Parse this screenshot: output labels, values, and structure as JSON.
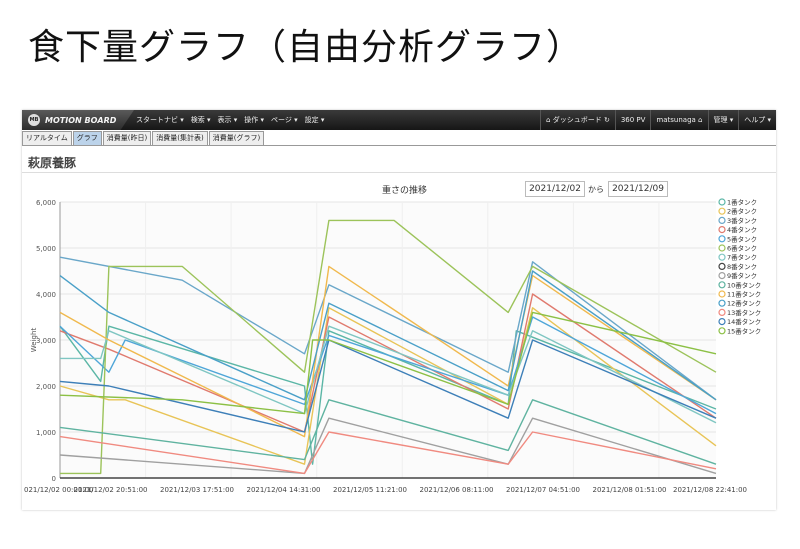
{
  "slide_title": "食下量グラフ（自由分析グラフ）",
  "app": {
    "brand": {
      "logo": "MB",
      "name": "MOTION BOARD"
    },
    "menu": [
      "スタートナビ ▾",
      "検索 ▾",
      "表示 ▾",
      "操作 ▾",
      "ページ ▾",
      "設定 ▾"
    ],
    "right": {
      "dashboard": "ダッシュボード",
      "pv": "360 PV",
      "user": "matsunaga",
      "manage": "管理 ▾",
      "help": "ヘルプ ▾"
    },
    "tabs": [
      "リアルタイム",
      "グラフ",
      "消費量(昨日)",
      "消費量(集計表)",
      "消費量(グラフ)"
    ],
    "active_tab": 1,
    "panel_title": "萩原養豚",
    "date_from": "2021/12/02",
    "date_sep": "から",
    "date_to": "2021/12/09"
  },
  "chart_data": {
    "type": "line",
    "title": "重さの推移",
    "ylabel": "Weight",
    "xlabel": "",
    "ylim": [
      0,
      6000
    ],
    "yticks": [
      0,
      1000,
      2000,
      3000,
      4000,
      5000,
      6000
    ],
    "ytick_labels": [
      "0",
      "1,000",
      "2,000",
      "3,000",
      "4,000",
      "5,000",
      "6,000"
    ],
    "xlim": [
      0,
      161
    ],
    "xtick_positions": [
      0,
      21,
      42,
      63,
      84,
      105,
      126,
      147
    ],
    "xtick_labels": [
      "021/12/02 00:01:00",
      "2021/12/02 20:51:00",
      "2021/12/03 17:51:00",
      "2021/12/04 14:31:00",
      "2021/12/05 11:21:00",
      "2021/12/06 08:11:00",
      "2021/12/07 04:51:00",
      "2021/12/08 01:51:00",
      "2021/12/08 22:41:00"
    ],
    "grid": true,
    "legend": "right",
    "series": [
      {
        "name": "1番タンク",
        "color": "#5bb6a6",
        "x": [
          0,
          10,
          12,
          60,
          62,
          66,
          110,
          112,
          161
        ],
        "y": [
          3300,
          2100,
          3300,
          2000,
          300,
          3200,
          1600,
          3200,
          1500
        ]
      },
      {
        "name": "2番タンク",
        "color": "#e8c457",
        "x": [
          0,
          12,
          16,
          60,
          66,
          110,
          116,
          161
        ],
        "y": [
          2000,
          1700,
          1700,
          300,
          3700,
          1600,
          3700,
          700
        ]
      },
      {
        "name": "3番タンク",
        "color": "#6aa7c9",
        "x": [
          0,
          30,
          60,
          66,
          110,
          116,
          161
        ],
        "y": [
          4800,
          4300,
          2700,
          4200,
          2300,
          4700,
          1700
        ]
      },
      {
        "name": "4番タンク",
        "color": "#e07a6e",
        "x": [
          0,
          12,
          60,
          66,
          110,
          116,
          161
        ],
        "y": [
          3200,
          2800,
          1000,
          3500,
          1500,
          4000,
          1300
        ]
      },
      {
        "name": "5番タンク",
        "color": "#4fa6d8",
        "x": [
          0,
          12,
          16,
          60,
          66,
          110,
          116,
          161
        ],
        "y": [
          3300,
          2300,
          3000,
          1600,
          3100,
          1800,
          3500,
          1400
        ]
      },
      {
        "name": "6番タンク",
        "color": "#9cc35a",
        "x": [
          0,
          10,
          12,
          30,
          60,
          66,
          82,
          110,
          116,
          161
        ],
        "y": [
          100,
          100,
          4600,
          4600,
          2300,
          5600,
          5600,
          3600,
          4600,
          2300
        ]
      },
      {
        "name": "7番タンク",
        "color": "#7fc6c2",
        "x": [
          0,
          10,
          12,
          60,
          66,
          110,
          116,
          161
        ],
        "y": [
          2600,
          2600,
          3200,
          1400,
          3300,
          1800,
          3200,
          1200
        ]
      },
      {
        "name": "8番タンク",
        "color": "#444444",
        "x": [
          0,
          161
        ],
        "y": [
          0,
          0
        ]
      },
      {
        "name": "9番タンク",
        "color": "#a0a0a0",
        "x": [
          0,
          60,
          66,
          110,
          116,
          161
        ],
        "y": [
          500,
          100,
          1300,
          300,
          1300,
          100
        ]
      },
      {
        "name": "10番タンク",
        "color": "#5fb3a0",
        "x": [
          0,
          60,
          66,
          110,
          116,
          161
        ],
        "y": [
          1100,
          400,
          1700,
          600,
          1700,
          300
        ]
      },
      {
        "name": "11番タンク",
        "color": "#f0b94e",
        "x": [
          0,
          12,
          60,
          66,
          110,
          116,
          161
        ],
        "y": [
          3600,
          3000,
          900,
          4600,
          2000,
          4400,
          1700
        ]
      },
      {
        "name": "12番タンク",
        "color": "#4aa0c8",
        "x": [
          0,
          12,
          60,
          66,
          110,
          116,
          161
        ],
        "y": [
          4400,
          3600,
          1700,
          3800,
          1900,
          4500,
          1700
        ]
      },
      {
        "name": "13番タンク",
        "color": "#f08a80",
        "x": [
          0,
          60,
          66,
          110,
          116,
          161
        ],
        "y": [
          900,
          100,
          1000,
          300,
          1000,
          200
        ]
      },
      {
        "name": "14番タンク",
        "color": "#3d7fb8",
        "x": [
          0,
          12,
          60,
          66,
          110,
          116,
          161
        ],
        "y": [
          2100,
          2000,
          1000,
          3000,
          1300,
          3000,
          1300
        ]
      },
      {
        "name": "15番タンク",
        "color": "#8cc045",
        "x": [
          0,
          30,
          60,
          62,
          66,
          110,
          116,
          161
        ],
        "y": [
          1800,
          1700,
          1400,
          3000,
          3000,
          1600,
          3600,
          2700
        ]
      }
    ]
  },
  "icons": {
    "dashboard": "home-icon",
    "refresh": "refresh-icon",
    "user": "user-home-icon"
  }
}
